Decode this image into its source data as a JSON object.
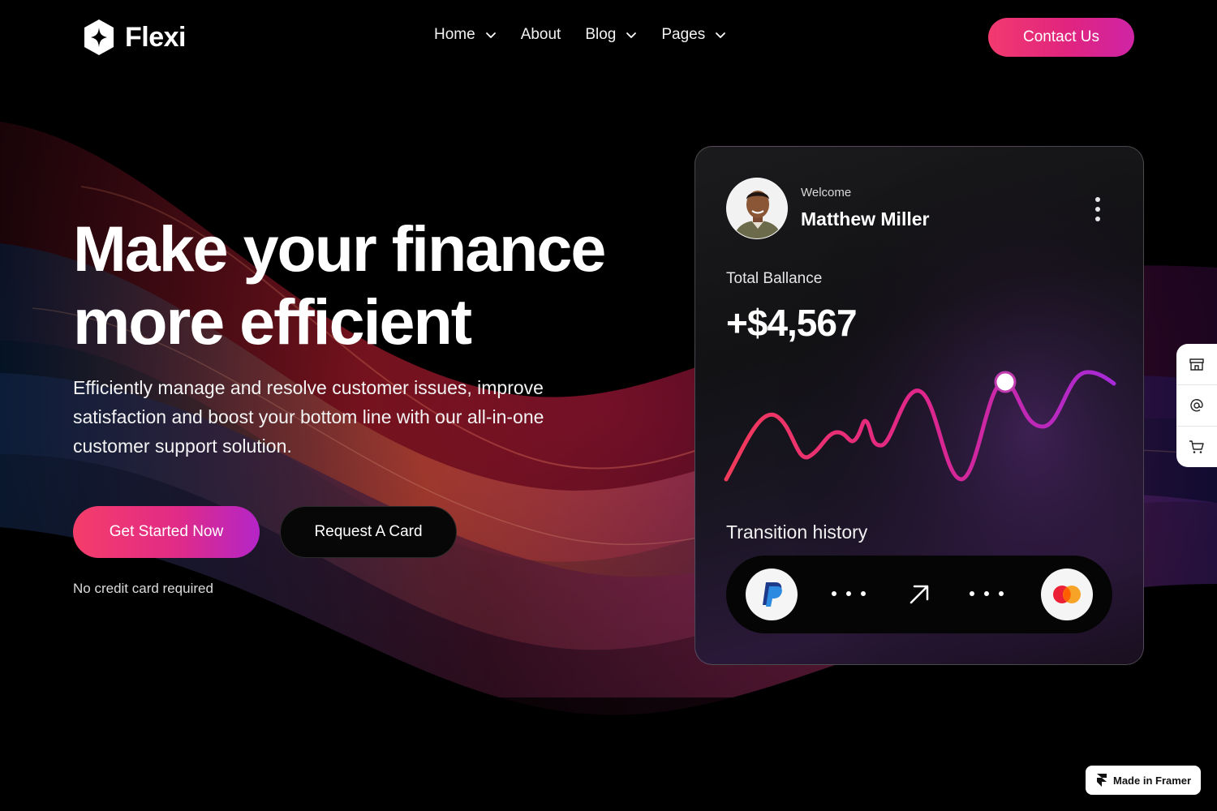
{
  "brand": {
    "name": "Flexi"
  },
  "nav": {
    "items": [
      {
        "label": "Home",
        "has_dropdown": true
      },
      {
        "label": "About",
        "has_dropdown": false
      },
      {
        "label": "Blog",
        "has_dropdown": true
      },
      {
        "label": "Pages",
        "has_dropdown": true
      }
    ],
    "contact_label": "Contact Us"
  },
  "hero": {
    "title_line1": "Make your finance",
    "title_line2": "more efficient",
    "subtitle": "Efficiently manage and resolve customer issues, improve satisfaction and boost your bottom line with our all-in-one customer support solution.",
    "primary_cta": "Get Started Now",
    "secondary_cta": "Request A Card",
    "note": "No credit card required"
  },
  "card": {
    "welcome": "Welcome",
    "user_name": "Matthew Miller",
    "balance_label": "Total Ballance",
    "balance_value": "+$4,567",
    "history_label": "Transition history",
    "history_from_icon": "paypal-icon",
    "history_to_icon": "mastercard-icon"
  },
  "side_toolbar": {
    "icons": [
      "store-icon",
      "at-sign-icon",
      "cart-icon"
    ]
  },
  "badge": {
    "label": "Made in Framer"
  },
  "colors": {
    "accent_pink": "#f23a6f",
    "accent_magenta": "#e0247f",
    "accent_purple": "#b425c8",
    "background": "#000000"
  }
}
